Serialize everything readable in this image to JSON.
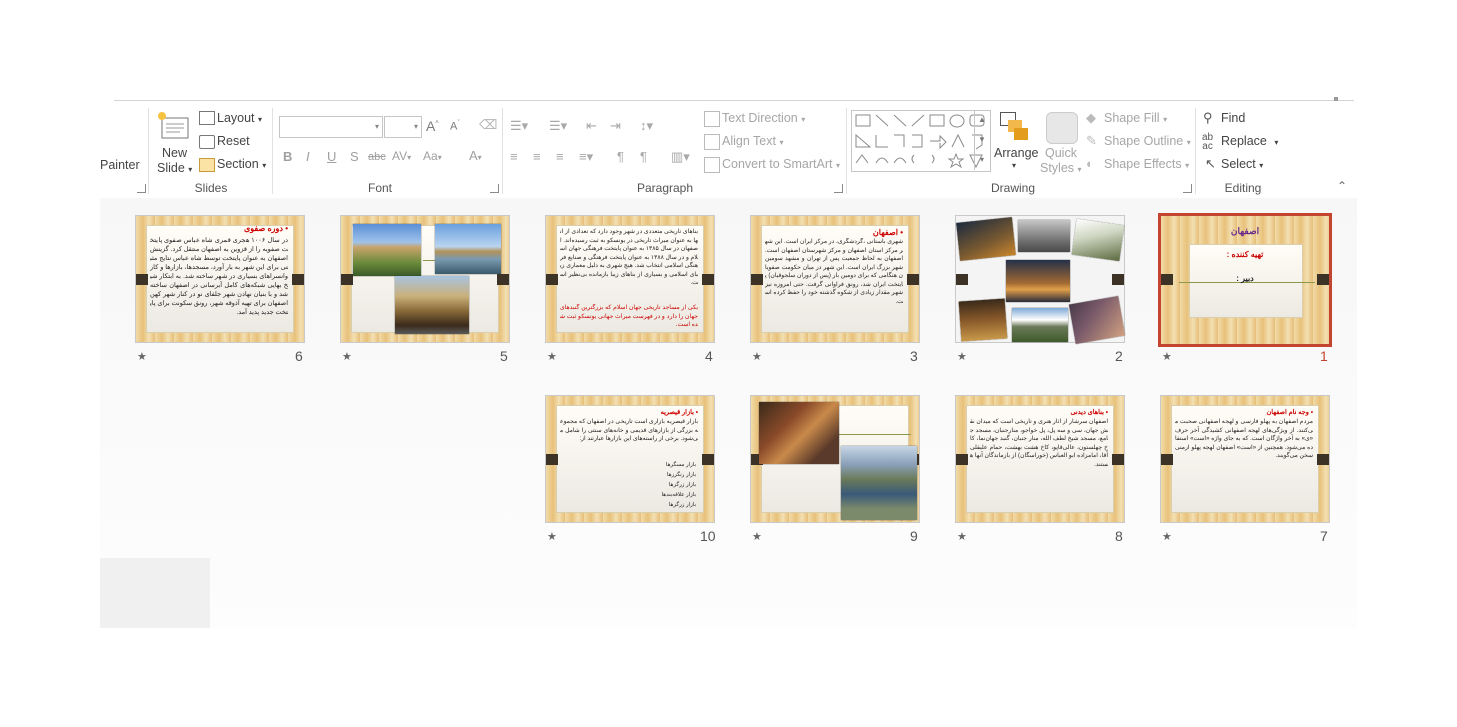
{
  "ribbon": {
    "clipboard": {
      "painter": "Painter"
    },
    "slides": {
      "new_slide_line1": "New",
      "new_slide_line2": "Slide",
      "layout": "Layout",
      "reset": "Reset",
      "section": "Section",
      "group": "Slides"
    },
    "font": {
      "group": "Font",
      "font_name": "",
      "font_size": ""
    },
    "paragraph": {
      "group": "Paragraph",
      "text_direction": "Text Direction",
      "align_text": "Align Text",
      "convert_smartart": "Convert to SmartArt"
    },
    "drawing": {
      "group": "Drawing",
      "arrange": "Arrange",
      "quick_line1": "Quick",
      "quick_line2": "Styles",
      "shape_fill": "Shape Fill",
      "shape_outline": "Shape Outline",
      "shape_effects": "Shape Effects"
    },
    "editing": {
      "group": "Editing",
      "find": "Find",
      "replace": "Replace",
      "select": "Select"
    },
    "format_glyphs": [
      "B",
      "I",
      "U",
      "S",
      "abc",
      "AV",
      "Aa",
      "A"
    ]
  },
  "slides": [
    {
      "number": "1",
      "selected": true,
      "title": "اصفهان",
      "line1": "تهیه کننده :",
      "line2": "دبیر :"
    },
    {
      "number": "2",
      "selected": false,
      "kind": "collage"
    },
    {
      "number": "3",
      "selected": false,
      "title": "• اصفهان",
      "text": "شهری باستانی ،گردشگری، در مرکز ایران است. این شهر مرکز استان اصفهان و مرکز شهرستان اصفهان است. اصفهان به لحاظ جمعیت پس از تهران و مشهد سومین شهر بزرگ ایران است. این شهر در میان حکومت صفویان هنگامی که برای دومین بار (پس از دوران سلجوقیان) پایتخت ایران شد، رونق فراوانی گرفت. حتی امروزه نیز شهر مقدار زیادی از شکوه گذشته خود را حفظ کرده است."
    },
    {
      "number": "4",
      "selected": false,
      "title": "",
      "text": "بناهای تاریخی متعددی در شهر وجود دارد که تعدادی از آنها به عنوان میراث تاریخی در یونسکو به ثبت رسیده‌اند. اصفهان در سال ۱۳۸۵ به عنوان پایتخت فرهنگی جهان اسلام و در سال ۱۳۸۸ به عنوان پایتخت فرهنگی و صنایع فرهنگی اسلامی انتخاب شد. هیچ شهری به دلیل معماری زیبای اسلامی و بسیاری از بناهای زیبا بازمانده بی‌نظیر است.",
      "red_text": "یکی از مساجد تاریخی جهان اسلام که بزرگترین گنبدهای جهان را دارد و در فهرست میراث جهانی یونسکو ثبت شده است."
    },
    {
      "number": "5",
      "selected": false,
      "kind": "photos"
    },
    {
      "number": "6",
      "selected": false,
      "title": "• دوره صفوی",
      "text": "در سال ۱۰۰۶ هجری قمری شاه عباس صفوی پایتخت صفویه را از قزوین به اصفهان منتقل کرد. گزینش اصفهان به عنوان پایتخت توسط شاه عباس نتایج مثبتی برای این شهر به بار آورد، مسجدها، بازارها و کاروانسراهای بسیاری در شهر ساخته شد. به ابتکار شیخ بهایی شبکه‌های کامل آبرسانی در اصفهان ساخته شد و با بنیان نهادن شهر جلفای نو در کنار شهر کهن اصفهان برای تهیه آذوقه شهر، رونق سکونت برای پایتخت جدید پدید آمد."
    },
    {
      "number": "7",
      "selected": false,
      "title": "• وجه نام اصفهان",
      "text": "مردم اصفهان به پهلو فارسی و لهجه اصفهانی صحبت می‌کنند. از ویژگی‌های لهجه اصفهانی کشیدگی آخر حرف «ی» به آخر واژگان است. که به جای واژه «است» استفاده می‌شود. همچنین از «است» اصفهان لهجه پهلو ارمنی سخن می‌گویند."
    },
    {
      "number": "8",
      "selected": false,
      "title": "• بناهای دیدنی",
      "text": "اصفهان سرشار از آثار هنری و تاریخی است که میدان نقش جهان، سی و سه پل، پل خواجو، منارجنبان، مسجد جامع، مسجد شیخ لطف الله، منار جنبان، گنبد جهان‌نما، کاخ چهلستون، عالی‌قاپو، کاخ هشت بهشت، حمام علیقلی آقا، امامزاده ابو العباس (خوراسگان) از بازماندگان آنها هستند."
    },
    {
      "number": "9",
      "selected": false,
      "kind": "photos2"
    },
    {
      "number": "10",
      "selected": false,
      "title": "• بازار قیصریه",
      "text": "بازار قیصریه بازاری است تاریخی در اصفهان که مجموعه بزرگی از بازارهای قدیمی و خانه‌های سنتی را شامل می‌شود. برخی از راسته‌های این بازارها عبارتند از:",
      "list": [
        "بازار مسگرها",
        "بازار رنگرزها",
        "بازار زرگرها",
        "بازار علاقه‌بندها",
        "بازار زرگرها"
      ]
    }
  ],
  "colors": {
    "selected_border": "#c4452f",
    "wood_light": "#f1dba7",
    "wood_dark": "#e6be78",
    "title_red": "#cc0000",
    "title_purple": "#6a2a8c"
  }
}
